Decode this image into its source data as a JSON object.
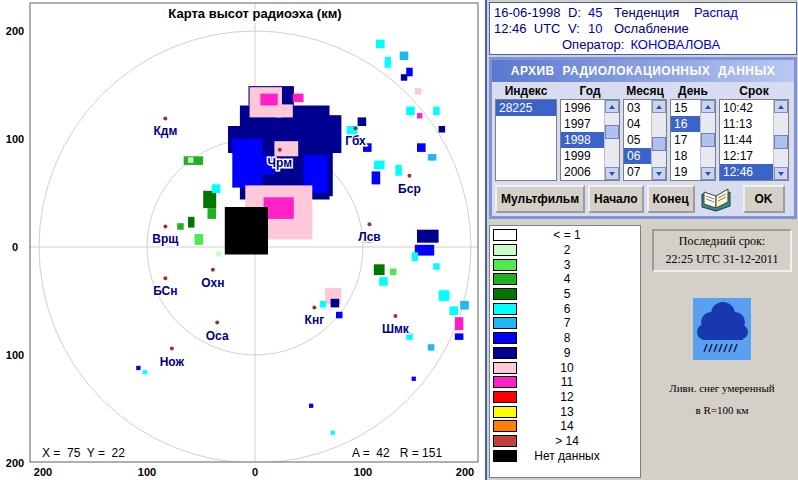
{
  "map": {
    "title": "Карта высот радиоэха (км)",
    "y_ticks": [
      "200",
      "100",
      "0",
      "100",
      "200"
    ],
    "x_ticks": [
      "200",
      "100",
      "0",
      "100",
      "200"
    ],
    "cursor": "X =  75  Y =  22",
    "bearing": "A =  42   R = 151",
    "stations": [
      {
        "name": "Кдм",
        "x": -83,
        "y": 119
      },
      {
        "name": "Чрм",
        "x": 23,
        "y": 90
      },
      {
        "name": "Гбх",
        "x": 93,
        "y": 110
      },
      {
        "name": "Бср",
        "x": 143,
        "y": 66
      },
      {
        "name": "Лсв",
        "x": 106,
        "y": 21
      },
      {
        "name": "Врщ",
        "x": -83,
        "y": 19
      },
      {
        "name": "БСн",
        "x": -83,
        "y": -29
      },
      {
        "name": "Охн",
        "x": -39,
        "y": -21
      },
      {
        "name": "Оса",
        "x": -35,
        "y": -70
      },
      {
        "name": "Нож",
        "x": -77,
        "y": -94
      },
      {
        "name": "Кнг",
        "x": 55,
        "y": -56
      },
      {
        "name": "Шмк",
        "x": 130,
        "y": -64
      }
    ],
    "echoes": [
      [
        -14,
        131,
        83,
        87,
        8
      ],
      [
        -6,
        149,
        42,
        18,
        8
      ],
      [
        55,
        122,
        25,
        35,
        8
      ],
      [
        40,
        92,
        32,
        45,
        8
      ],
      [
        -25,
        112,
        14,
        25,
        8
      ],
      [
        -21,
        100,
        28,
        45,
        7
      ],
      [
        45,
        85,
        22,
        35,
        7
      ],
      [
        0,
        85,
        18,
        18,
        7
      ],
      [
        -5,
        148,
        30,
        28,
        9
      ],
      [
        20,
        132,
        15,
        12,
        9
      ],
      [
        5,
        142,
        16,
        11,
        10
      ],
      [
        35,
        142,
        10,
        8,
        10
      ],
      [
        18,
        98,
        22,
        14,
        9
      ],
      [
        -9,
        57,
        62,
        50,
        9
      ],
      [
        8,
        46,
        28,
        20,
        10
      ],
      [
        -28,
        37,
        40,
        44,
        15
      ],
      [
        -48,
        52,
        12,
        16,
        4
      ],
      [
        -44,
        36,
        8,
        10,
        3
      ],
      [
        -40,
        58,
        8,
        8,
        5
      ],
      [
        -56,
        12,
        8,
        10,
        2
      ],
      [
        -36,
        -4,
        5,
        5,
        1
      ],
      [
        -62,
        28,
        6,
        10,
        4
      ],
      [
        -72,
        22,
        6,
        6,
        3
      ],
      [
        -66,
        84,
        18,
        8,
        3
      ],
      [
        -62,
        83,
        5,
        5,
        1
      ],
      [
        112,
        192,
        8,
        8,
        5
      ],
      [
        120,
        176,
        6,
        10,
        5
      ],
      [
        134,
        181,
        8,
        8,
        6
      ],
      [
        140,
        166,
        6,
        8,
        7
      ],
      [
        148,
        147,
        6,
        6,
        9
      ],
      [
        135,
        160,
        6,
        6,
        8
      ],
      [
        140,
        130,
        8,
        8,
        5
      ],
      [
        150,
        124,
        5,
        5,
        10
      ],
      [
        165,
        130,
        6,
        8,
        5
      ],
      [
        170,
        112,
        6,
        6,
        8
      ],
      [
        85,
        112,
        10,
        10,
        5
      ],
      [
        95,
        120,
        8,
        8,
        8
      ],
      [
        100,
        96,
        8,
        8,
        7
      ],
      [
        110,
        80,
        10,
        8,
        5
      ],
      [
        108,
        70,
        8,
        12,
        7
      ],
      [
        130,
        76,
        6,
        10,
        5
      ],
      [
        150,
        96,
        8,
        8,
        7
      ],
      [
        160,
        86,
        8,
        6,
        6
      ],
      [
        100,
        10,
        8,
        6,
        3
      ],
      [
        150,
        16,
        20,
        12,
        8
      ],
      [
        148,
        2,
        18,
        10,
        7
      ],
      [
        145,
        -5,
        6,
        8,
        5
      ],
      [
        165,
        -15,
        6,
        6,
        5
      ],
      [
        110,
        -16,
        10,
        10,
        4
      ],
      [
        115,
        -28,
        8,
        8,
        5
      ],
      [
        125,
        -20,
        6,
        6,
        2
      ],
      [
        170,
        -40,
        10,
        10,
        5
      ],
      [
        180,
        -55,
        8,
        8,
        5
      ],
      [
        185,
        -65,
        8,
        12,
        10
      ],
      [
        190,
        -50,
        8,
        8,
        6
      ],
      [
        185,
        -80,
        8,
        6,
        7
      ],
      [
        140,
        -80,
        6,
        6,
        5
      ],
      [
        160,
        -90,
        6,
        6,
        6
      ],
      [
        65,
        -38,
        15,
        15,
        9
      ],
      [
        70,
        -48,
        8,
        8,
        8
      ],
      [
        60,
        -50,
        6,
        6,
        5
      ],
      [
        75,
        -60,
        6,
        6,
        7
      ],
      [
        145,
        -120,
        4,
        4,
        7
      ],
      [
        50,
        -145,
        4,
        4,
        7
      ],
      [
        70,
        -170,
        4,
        4,
        5
      ],
      [
        -110,
        -110,
        4,
        4,
        7
      ],
      [
        -104,
        -114,
        4,
        4,
        5
      ]
    ]
  },
  "info": {
    "date": "16-06-1998",
    "time": "12:46  UTC",
    "d_label": "D:",
    "d_value": "45",
    "v_label": "V:",
    "v_value": "10",
    "trend_label": "Тенденция",
    "trend_value": "Распад",
    "trend_desc": "Ослабление",
    "operator_label": "Оператор:",
    "operator": "КОНОВАЛОВА"
  },
  "archive": {
    "title": "АРХИВ  РАДИОЛОКАЦИОННЫХ  ДАННЫХ",
    "columns": [
      {
        "header": "Индекс",
        "scroll": null,
        "items": [
          {
            "label": "28225",
            "selected": true
          }
        ]
      },
      {
        "header": "Год",
        "scroll": {
          "level": 0.3
        },
        "items": [
          {
            "label": "1996",
            "selected": false
          },
          {
            "label": "1997",
            "selected": false
          },
          {
            "label": "1998",
            "selected": true
          },
          {
            "label": "1999",
            "selected": false
          },
          {
            "label": "2006",
            "selected": false
          }
        ]
      },
      {
        "header": "Месяц",
        "scroll": {
          "level": 0.6
        },
        "items": [
          {
            "label": "03",
            "selected": false
          },
          {
            "label": "04",
            "selected": false
          },
          {
            "label": "05",
            "selected": false
          },
          {
            "label": "06",
            "selected": true
          },
          {
            "label": "07",
            "selected": false
          }
        ]
      },
      {
        "header": "День",
        "scroll": {
          "level": 0.5
        },
        "items": [
          {
            "label": "15",
            "selected": false
          },
          {
            "label": "16",
            "selected": true
          },
          {
            "label": "17",
            "selected": false
          },
          {
            "label": "18",
            "selected": false
          },
          {
            "label": "19",
            "selected": false
          }
        ]
      },
      {
        "header": "Срок",
        "scroll": {
          "level": 0.55
        },
        "items": [
          {
            "label": "10:42",
            "selected": false
          },
          {
            "label": "11:13",
            "selected": false
          },
          {
            "label": "11:44",
            "selected": false
          },
          {
            "label": "12:17",
            "selected": false
          },
          {
            "label": "12:46",
            "selected": true
          }
        ]
      }
    ],
    "buttons": [
      "Мультфильм",
      "Начало",
      "Конец"
    ],
    "ok_button": "OK"
  },
  "legend": [
    {
      "label": "< = 1",
      "color": "#ffffff"
    },
    {
      "label": "2",
      "color": "#c8ffc8"
    },
    {
      "label": "3",
      "color": "#50e850"
    },
    {
      "label": "4",
      "color": "#20b020"
    },
    {
      "label": "5",
      "color": "#007800"
    },
    {
      "label": "6",
      "color": "#00ffff"
    },
    {
      "label": "7",
      "color": "#20b8f0"
    },
    {
      "label": "8",
      "color": "#0000ff"
    },
    {
      "label": "9",
      "color": "#000090"
    },
    {
      "label": "10",
      "color": "#ffc8d8"
    },
    {
      "label": "11",
      "color": "#ff20c8"
    },
    {
      "label": "12",
      "color": "#ff0000"
    },
    {
      "label": "13",
      "color": "#ffff00"
    },
    {
      "label": "14",
      "color": "#ff8000"
    },
    {
      "label": "> 14",
      "color": "#c04040"
    },
    {
      "label": "Нет данных",
      "color": "#000000"
    }
  ],
  "last": {
    "title": "Последний срок:",
    "value": "22:25 UTC 31-12-2011"
  },
  "weather": {
    "line1": "Ливн. снег умеренный",
    "line2": "в R=100 км"
  }
}
